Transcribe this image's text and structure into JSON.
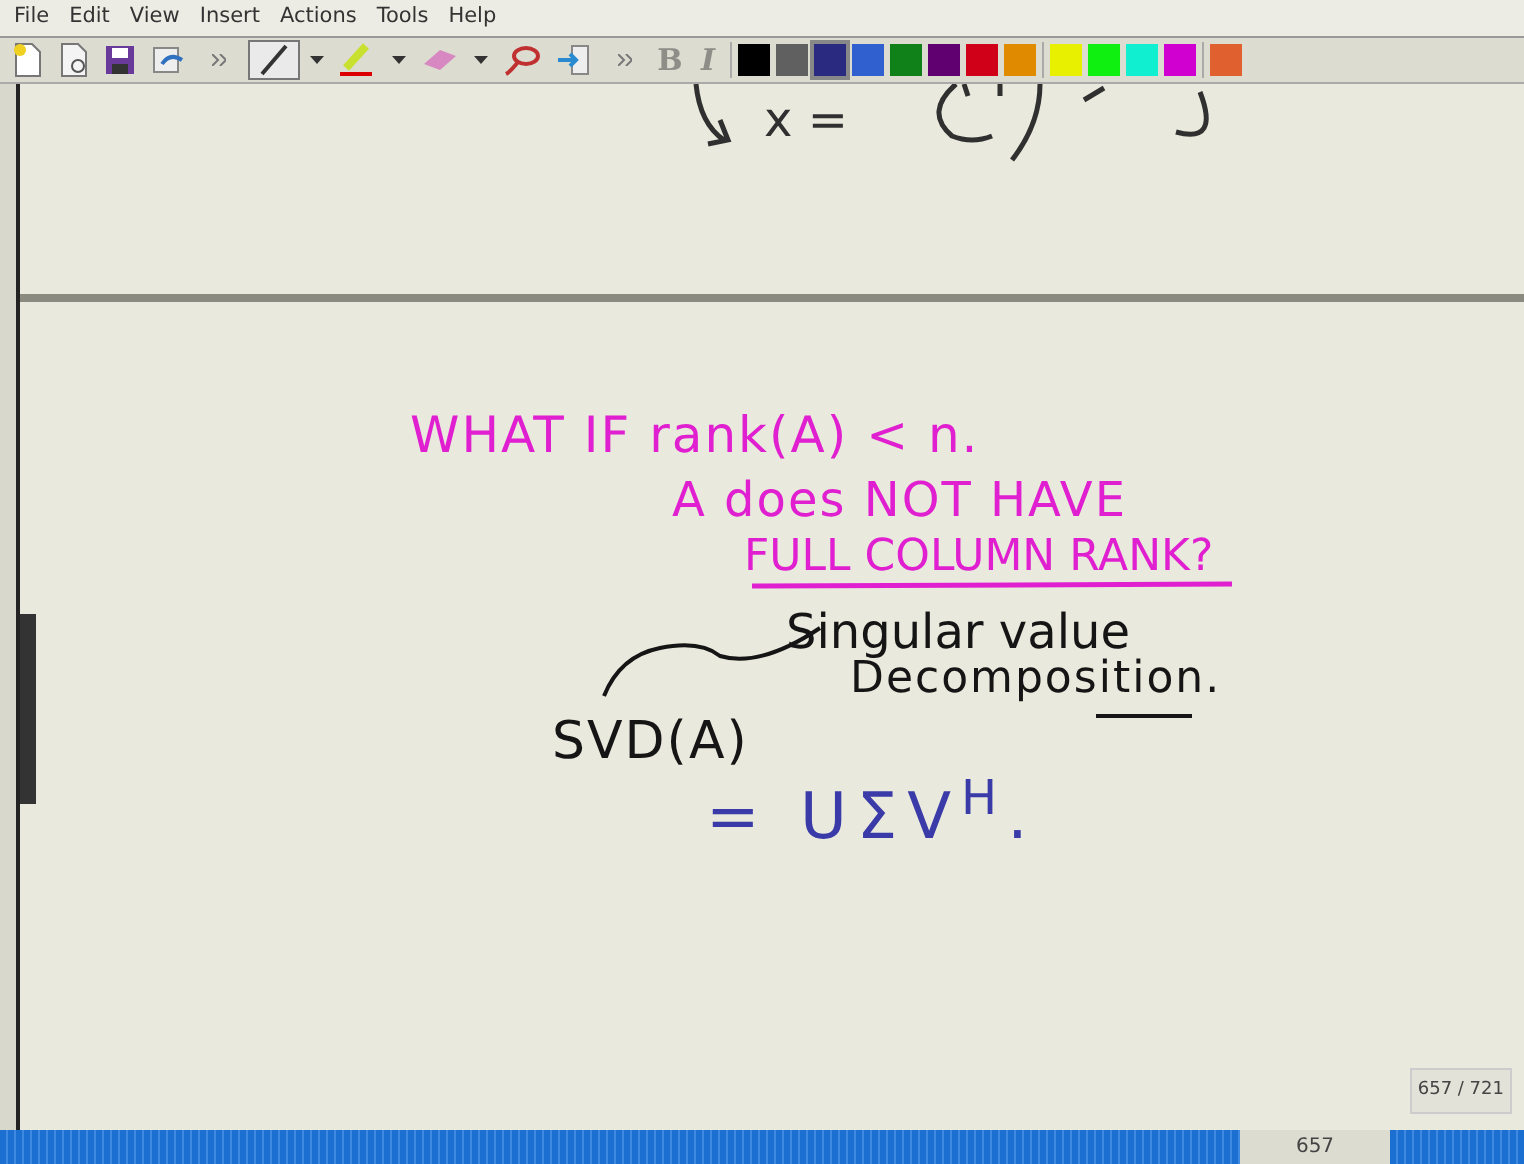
{
  "menu": [
    "File",
    "Edit",
    "View",
    "Insert",
    "Actions",
    "Tools",
    "Help"
  ],
  "tools": [
    {
      "kind": "pen",
      "selected": true
    },
    {
      "kind": "highlighter",
      "selected": false
    },
    {
      "kind": "eraser",
      "selected": false
    },
    {
      "kind": "lasso",
      "selected": false
    }
  ],
  "format_buttons": [
    {
      "label": "B",
      "disabled": true
    },
    {
      "label": "I",
      "disabled": true
    }
  ],
  "swatches": [
    {
      "color": "#000000",
      "selected": false
    },
    {
      "color": "#606060",
      "selected": false
    },
    {
      "color": "#2a2a80",
      "selected": true
    },
    {
      "color": "#3060d0",
      "selected": false
    },
    {
      "color": "#108018",
      "selected": false
    },
    {
      "color": "#600070",
      "selected": false
    },
    {
      "color": "#d00018",
      "selected": false
    },
    {
      "color": "#e08a00",
      "selected": false
    },
    {
      "color": "#e8f000",
      "selected": false
    },
    {
      "color": "#10f010",
      "selected": false
    },
    {
      "color": "#10f0d0",
      "selected": false
    },
    {
      "color": "#d000d0",
      "selected": false
    },
    {
      "color": "#e06030",
      "selected": false
    }
  ],
  "ink": [
    {
      "text": "x =",
      "color": "#303030"
    },
    {
      "text": "WHAT IF rank(A) < n.",
      "color": "#e020d0"
    },
    {
      "text": "A does NOT HAVE",
      "color": "#e020d0"
    },
    {
      "text": "FULL COLUMN RANK?",
      "color": "#e020d0"
    },
    {
      "text": "Singular value",
      "color": "#151515"
    },
    {
      "text": "Decomposition.",
      "color": "#151515"
    },
    {
      "text": "SVD(A)",
      "color": "#151515"
    },
    {
      "text": "= UΣV$^{H}$.",
      "color": "#3a3aa8"
    }
  ],
  "page_indicator": "657 / 721",
  "status_bar": {
    "page": "657"
  }
}
